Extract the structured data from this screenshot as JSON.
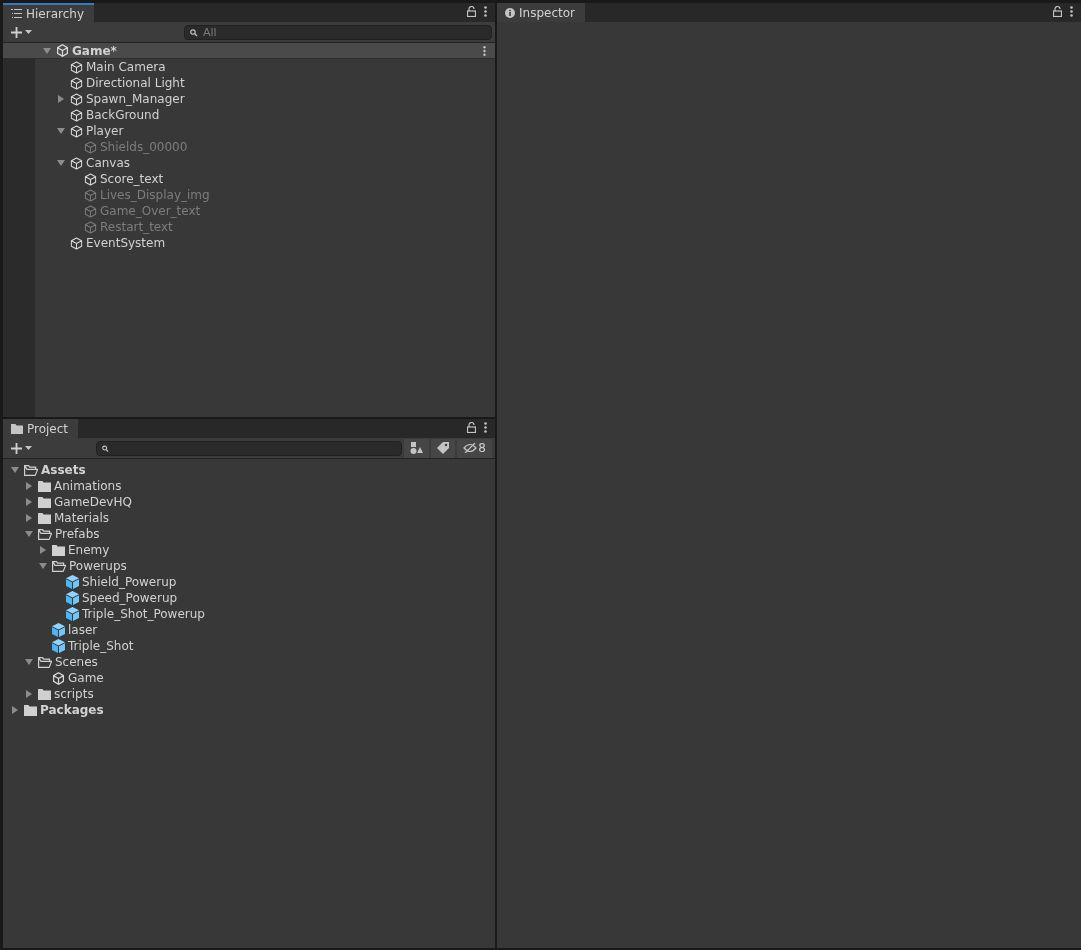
{
  "hierarchy": {
    "tab": "Hierarchy",
    "search": {
      "placeholder": "All"
    },
    "scene": {
      "name": "Game*",
      "kind": "scene",
      "expanded": true,
      "children": [
        {
          "name": "Main Camera",
          "kind": "gameobject",
          "active": true
        },
        {
          "name": "Directional Light",
          "kind": "gameobject",
          "active": true
        },
        {
          "name": "Spawn_Manager",
          "kind": "gameobject",
          "active": true,
          "expanded": false
        },
        {
          "name": "BackGround",
          "kind": "gameobject",
          "active": true
        },
        {
          "name": "Player",
          "kind": "gameobject",
          "active": true,
          "expanded": true,
          "children": [
            {
              "name": "Shields_00000",
              "kind": "gameobject",
              "active": false
            }
          ]
        },
        {
          "name": "Canvas",
          "kind": "gameobject",
          "active": true,
          "expanded": true,
          "children": [
            {
              "name": "Score_text",
              "kind": "gameobject",
              "active": true
            },
            {
              "name": "Lives_Display_img",
              "kind": "gameobject",
              "active": false
            },
            {
              "name": "Game_Over_text",
              "kind": "gameobject",
              "active": false
            },
            {
              "name": "Restart_text",
              "kind": "gameobject",
              "active": false
            }
          ]
        },
        {
          "name": "EventSystem",
          "kind": "gameobject",
          "active": true
        }
      ]
    }
  },
  "project": {
    "tab": "Project",
    "hidden_count": "8",
    "tree": [
      {
        "name": "Assets",
        "kind": "folder",
        "expanded": true,
        "children": [
          {
            "name": "Animations",
            "kind": "folder",
            "expanded": false
          },
          {
            "name": "GameDevHQ",
            "kind": "folder",
            "expanded": false
          },
          {
            "name": "Materials",
            "kind": "folder",
            "expanded": false
          },
          {
            "name": "Prefabs",
            "kind": "folder",
            "expanded": true,
            "children": [
              {
                "name": "Enemy",
                "kind": "folder",
                "expanded": false
              },
              {
                "name": "Powerups",
                "kind": "folder",
                "expanded": true,
                "children": [
                  {
                    "name": "Shield_Powerup",
                    "kind": "prefab"
                  },
                  {
                    "name": "Speed_Powerup",
                    "kind": "prefab"
                  },
                  {
                    "name": "Triple_Shot_Powerup",
                    "kind": "prefab"
                  }
                ]
              },
              {
                "name": "laser",
                "kind": "prefab"
              },
              {
                "name": "Triple_Shot",
                "kind": "prefab"
              }
            ]
          },
          {
            "name": "Scenes",
            "kind": "folder",
            "expanded": true,
            "children": [
              {
                "name": "Game",
                "kind": "scene"
              }
            ]
          },
          {
            "name": "scripts",
            "kind": "folder",
            "expanded": false
          }
        ]
      },
      {
        "name": "Packages",
        "kind": "folder",
        "expanded": false
      }
    ]
  },
  "inspector": {
    "tab": "Inspector"
  }
}
